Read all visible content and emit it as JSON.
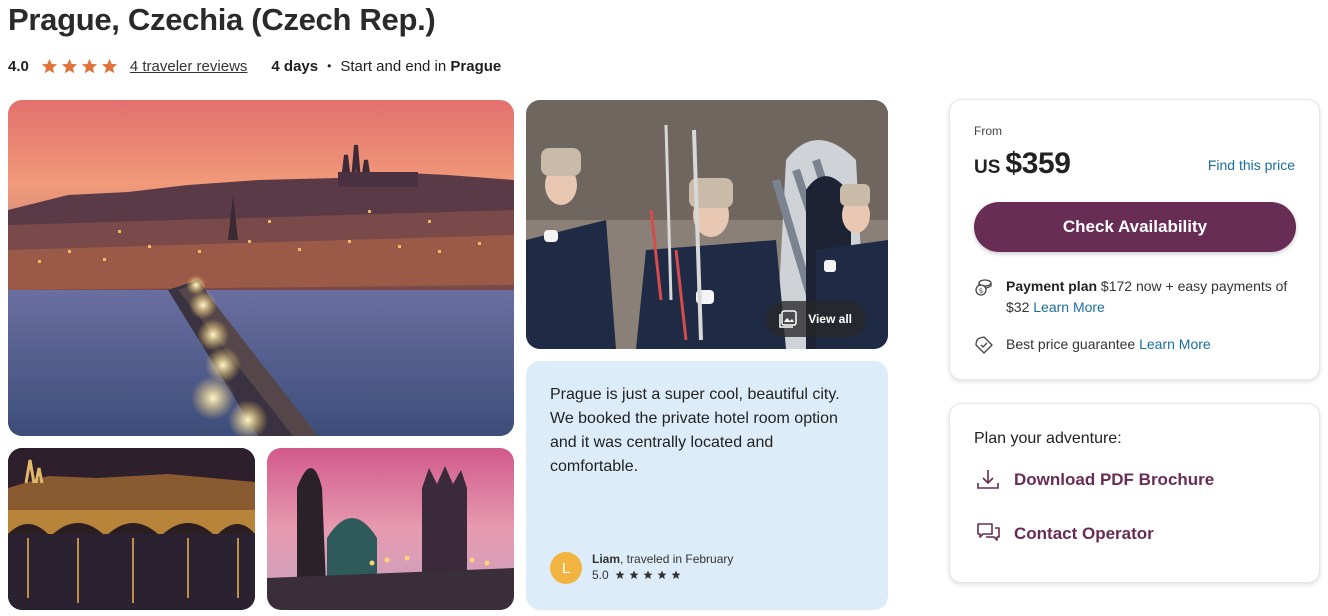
{
  "header": {
    "title": "Prague, Czechia (Czech Rep.)",
    "rating": "4.0",
    "stars": 4,
    "reviews_link": "4 traveler reviews",
    "duration": "4 days",
    "separator": "•",
    "start_end_prefix": "Start and end in",
    "start_end_city": "Prague"
  },
  "gallery": {
    "view_all_label": "View all"
  },
  "review": {
    "quote": "Prague is just a super cool, beautiful city. We booked the private hotel room option and it was centrally located and comfortable.",
    "avatar_initial": "L",
    "author": "Liam",
    "traveled": ", traveled in February",
    "rating": "5.0",
    "stars": 5
  },
  "pricing": {
    "from_label": "From",
    "currency": "US",
    "amount": "$359",
    "find_price": "Find this price",
    "cta": "Check Availability",
    "payment_title": "Payment plan",
    "payment_text": " $172 now + easy payments of $32 ",
    "payment_link": "Learn More",
    "guarantee_text": "Best price guarantee ",
    "guarantee_link": "Learn More"
  },
  "plan": {
    "title": "Plan your adventure:",
    "download": "Download PDF Brochure",
    "contact": "Contact Operator"
  },
  "colors": {
    "star": "#e0733a",
    "brand": "#672d55",
    "link": "#1a6e9c",
    "review_bg": "#dcedf9"
  },
  "icons": {
    "star": "star-icon",
    "gallery": "gallery-icon",
    "payment": "coins-icon",
    "guarantee": "price-tag-icon",
    "download": "download-icon",
    "contact": "chat-bubbles-icon"
  }
}
